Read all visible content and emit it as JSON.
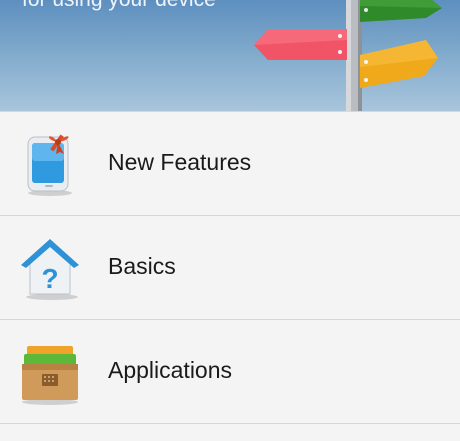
{
  "hero": {
    "subtitle": "for using your device"
  },
  "menu": {
    "items": [
      {
        "label": "New Features",
        "icon": "phone-gift-icon"
      },
      {
        "label": "Basics",
        "icon": "house-question-icon"
      },
      {
        "label": "Applications",
        "icon": "app-box-icon"
      }
    ]
  },
  "colors": {
    "sky_top": "#5d8fbf",
    "sky_bottom": "#a9c5dc",
    "sign_green": "#2f8a2a",
    "sign_red": "#f25467",
    "sign_orange": "#f0a91b",
    "menu_background": "#f4f4f4",
    "divider": "#d6d6d6"
  }
}
